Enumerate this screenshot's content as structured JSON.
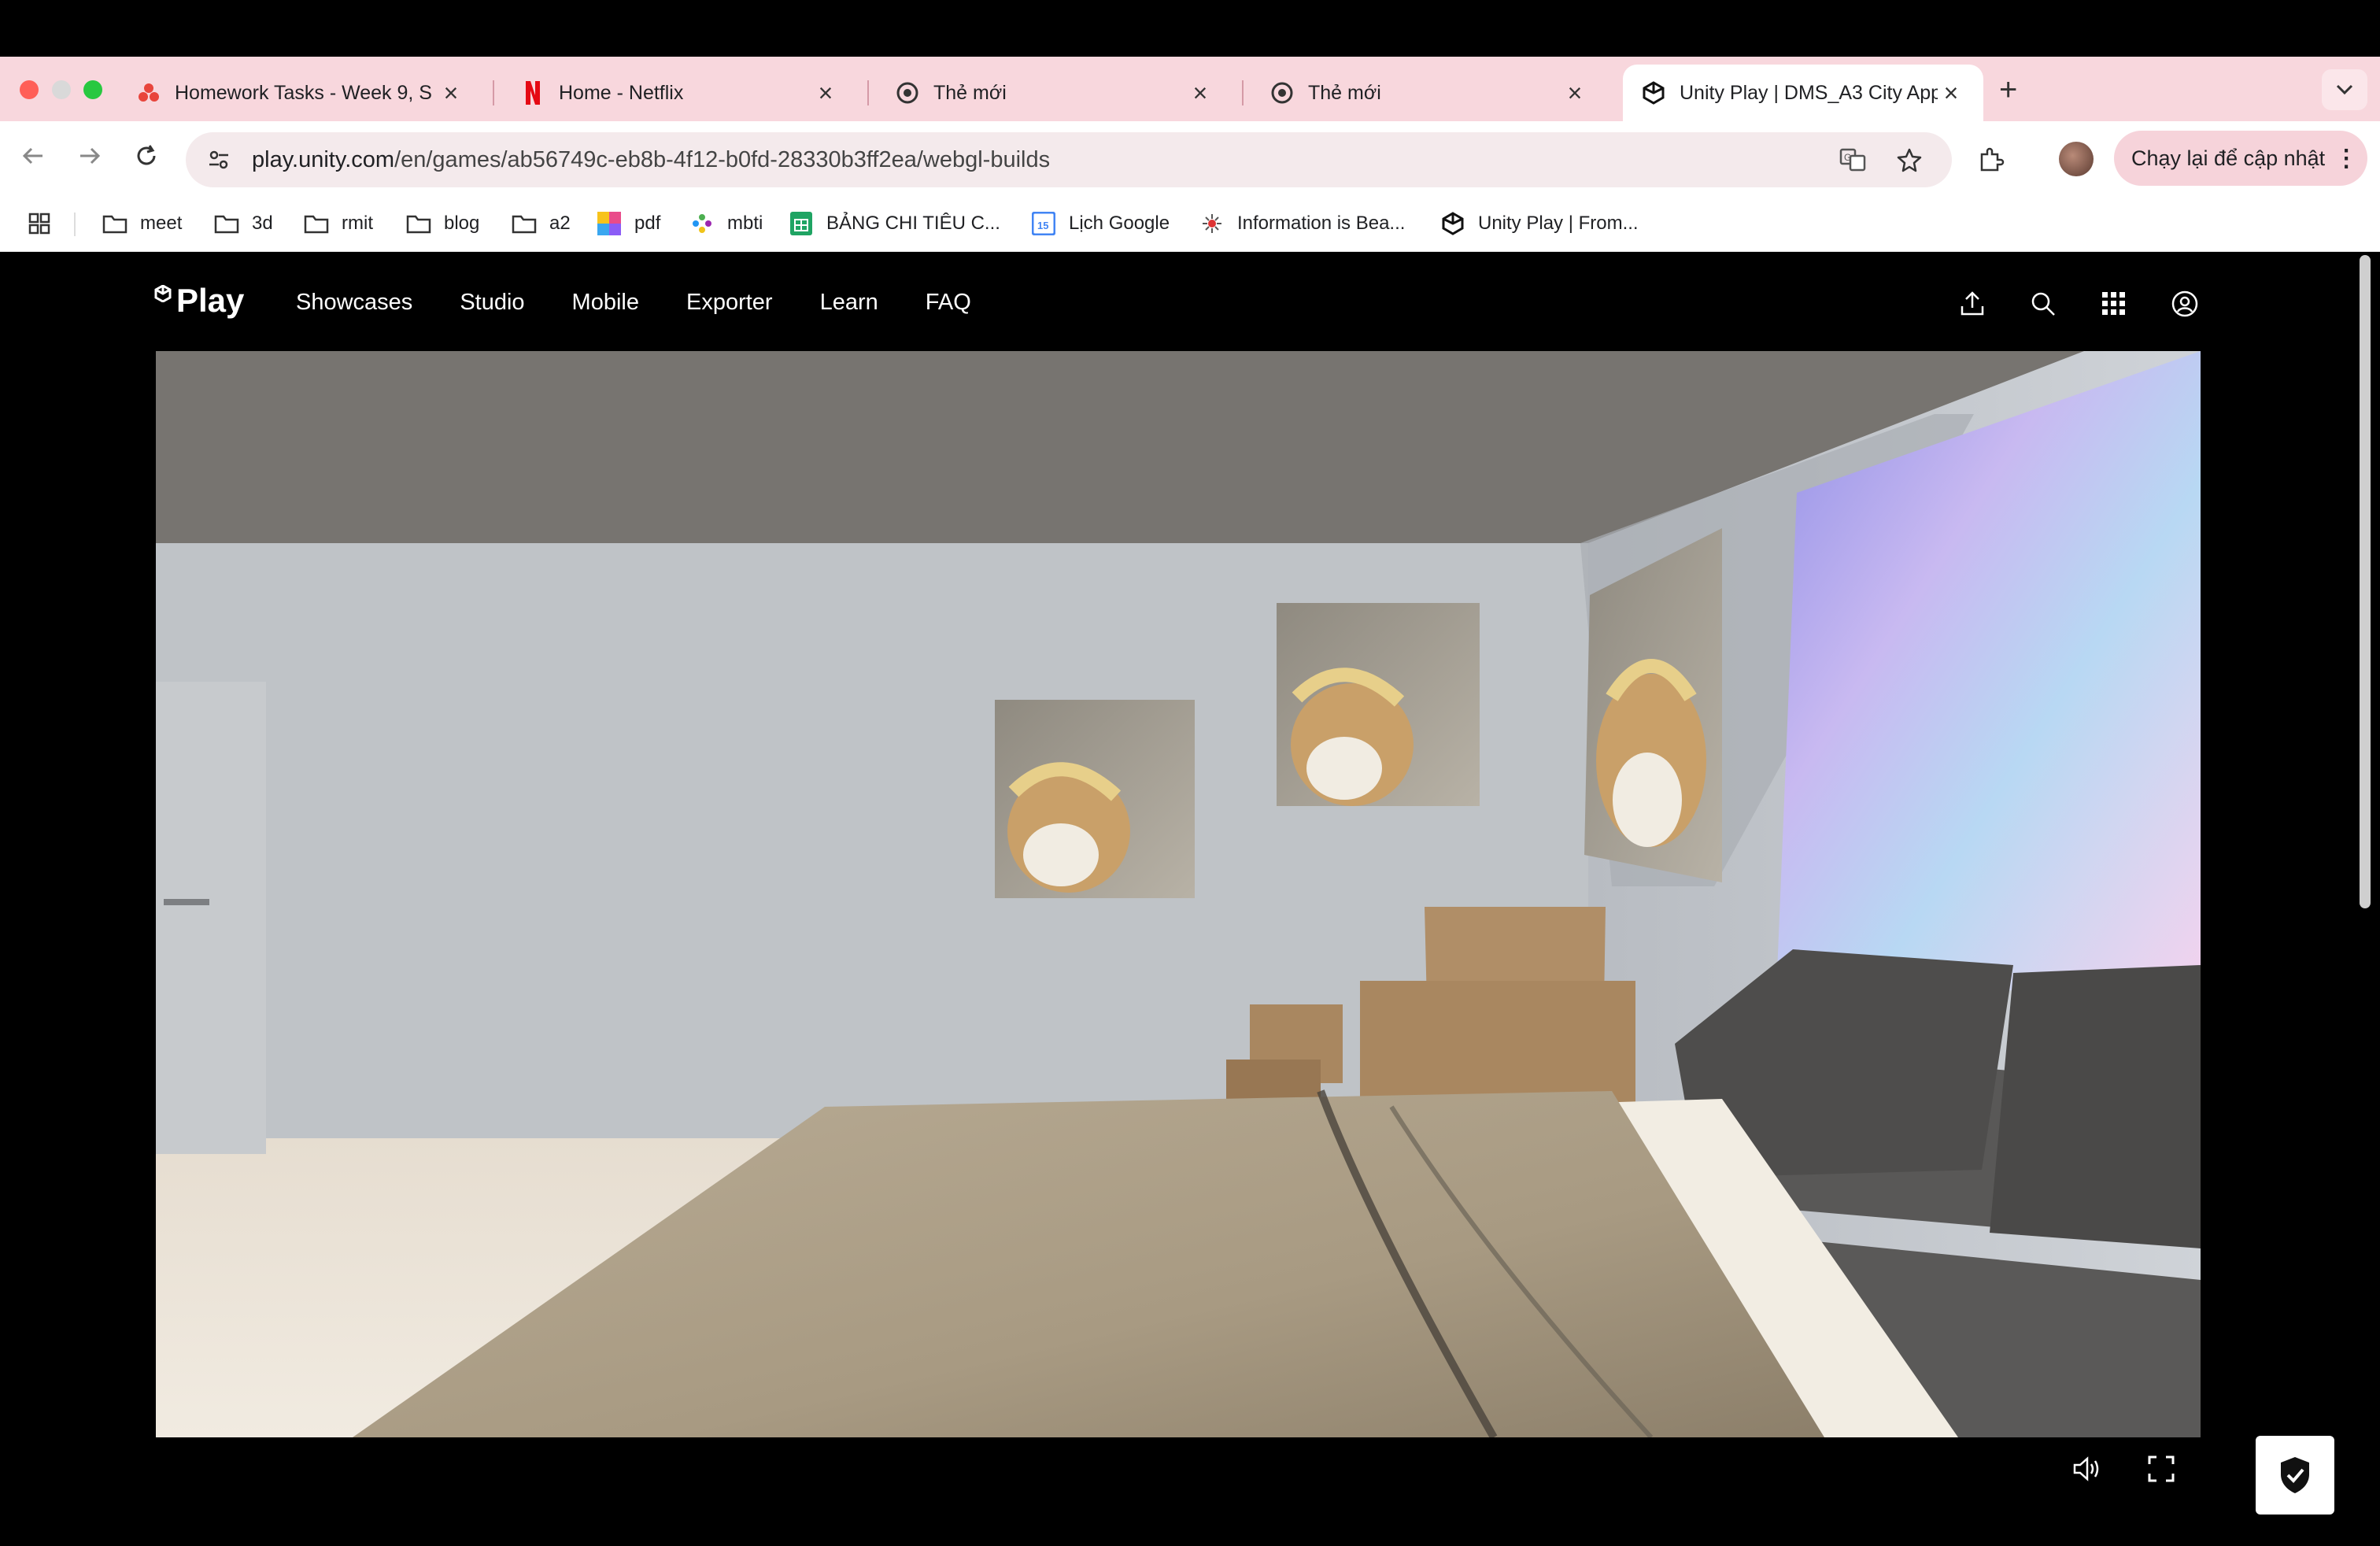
{
  "browser": {
    "tabs": [
      {
        "label": "Homework Tasks - Week 9, S",
        "favicon": "asana-icon"
      },
      {
        "label": "Home - Netflix",
        "favicon": "netflix-icon"
      },
      {
        "label": "Thẻ mới",
        "favicon": "chrome-icon"
      },
      {
        "label": "Thẻ mới",
        "favicon": "chrome-icon"
      },
      {
        "label": "Unity Play | DMS_A3 City App",
        "favicon": "unity-icon",
        "active": true
      }
    ],
    "url_host": "play.unity.com",
    "url_path": "/en/games/ab56749c-eb8b-4f12-b0fd-28330b3ff2ea/webgl-builds",
    "update_button": "Chạy lại để cập nhật",
    "bookmarks": [
      {
        "label": "meet",
        "icon": "folder-icon"
      },
      {
        "label": "3d",
        "icon": "folder-icon"
      },
      {
        "label": "rmit",
        "icon": "folder-icon"
      },
      {
        "label": "blog",
        "icon": "folder-icon"
      },
      {
        "label": "a2",
        "icon": "folder-icon"
      },
      {
        "label": "pdf",
        "icon": "color-grid-icon"
      },
      {
        "label": "mbti",
        "icon": "mbti-icon"
      },
      {
        "label": "BẢNG CHI TIÊU C...",
        "icon": "sheets-icon"
      },
      {
        "label": "Lịch Google",
        "icon": "calendar-icon"
      },
      {
        "label": "Information is Bea...",
        "icon": "info-beautiful-icon"
      },
      {
        "label": "Unity Play | From...",
        "icon": "unity-icon"
      }
    ]
  },
  "site": {
    "logo": "Play",
    "nav": [
      "Showcases",
      "Studio",
      "Mobile",
      "Exporter",
      "Learn",
      "FAQ"
    ]
  },
  "colors": {
    "tabstrip": "#f8d7dd",
    "update_button": "#f6d3da",
    "page_bg": "#000000"
  }
}
